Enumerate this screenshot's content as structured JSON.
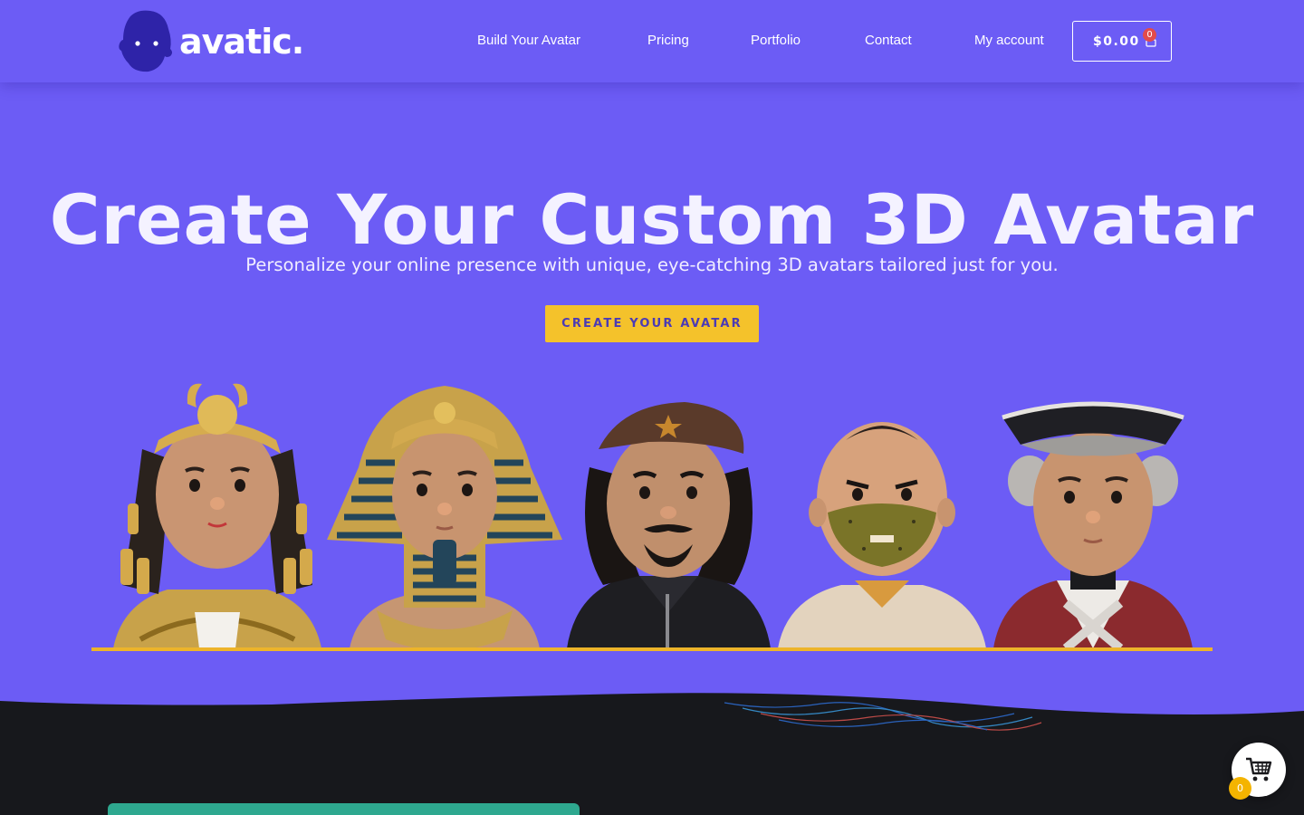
{
  "brand": {
    "name": "avatic.",
    "accent": "#6C5CF5",
    "cta_color": "#F4C22B",
    "dark_bg": "#17181C"
  },
  "nav": {
    "items": [
      {
        "label": "Build Your Avatar"
      },
      {
        "label": "Pricing"
      },
      {
        "label": "Portfolio"
      },
      {
        "label": "Contact"
      },
      {
        "label": "My account"
      }
    ],
    "cart_total": "$0.00",
    "cart_count": "0"
  },
  "hero": {
    "title": "Create Your Custom 3D Avatar",
    "subtitle": "Personalize your online presence with unique, eye-catching 3D avatars tailored just for you.",
    "cta_label": "CREATE YOUR AVATAR"
  },
  "avatars": [
    {
      "name": "cleopatra-avatar"
    },
    {
      "name": "pharaoh-avatar"
    },
    {
      "name": "revolutionary-beret-avatar"
    },
    {
      "name": "masked-man-avatar"
    },
    {
      "name": "colonial-soldier-avatar"
    }
  ],
  "floating_cart": {
    "count": "0",
    "icon": "shopping-cart-icon"
  }
}
